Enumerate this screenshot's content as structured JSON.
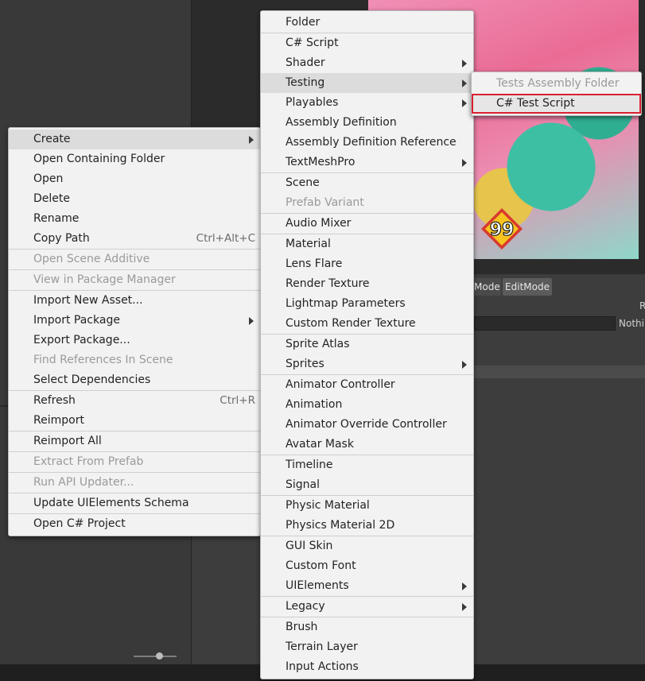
{
  "background": {
    "tabs": [
      "Mode",
      "EditMode"
    ],
    "labels": {
      "nothing": "Nothin",
      "r": "R"
    },
    "badge_text": "99"
  },
  "context_menu": {
    "groups": [
      [
        {
          "label": "Create",
          "submenu": true,
          "highlighted": true
        },
        {
          "label": "Open Containing Folder"
        },
        {
          "label": "Open"
        },
        {
          "label": "Delete"
        },
        {
          "label": "Rename"
        },
        {
          "label": "Copy Path",
          "shortcut": "Ctrl+Alt+C"
        }
      ],
      [
        {
          "label": "Open Scene Additive",
          "disabled": true
        }
      ],
      [
        {
          "label": "View in Package Manager",
          "disabled": true
        }
      ],
      [
        {
          "label": "Import New Asset..."
        },
        {
          "label": "Import Package",
          "submenu": true
        },
        {
          "label": "Export Package..."
        },
        {
          "label": "Find References In Scene",
          "disabled": true
        },
        {
          "label": "Select Dependencies"
        }
      ],
      [
        {
          "label": "Refresh",
          "shortcut": "Ctrl+R"
        },
        {
          "label": "Reimport"
        }
      ],
      [
        {
          "label": "Reimport All"
        }
      ],
      [
        {
          "label": "Extract From Prefab",
          "disabled": true
        }
      ],
      [
        {
          "label": "Run API Updater...",
          "disabled": true
        }
      ],
      [
        {
          "label": "Update UIElements Schema"
        }
      ],
      [
        {
          "label": "Open C# Project"
        }
      ]
    ]
  },
  "create_menu": {
    "groups": [
      [
        {
          "label": "Folder"
        }
      ],
      [
        {
          "label": "C# Script"
        },
        {
          "label": "Shader",
          "submenu": true
        },
        {
          "label": "Testing",
          "submenu": true,
          "highlighted": true
        },
        {
          "label": "Playables",
          "submenu": true
        },
        {
          "label": "Assembly Definition"
        },
        {
          "label": "Assembly Definition Reference"
        },
        {
          "label": "TextMeshPro",
          "submenu": true
        }
      ],
      [
        {
          "label": "Scene"
        },
        {
          "label": "Prefab Variant",
          "disabled": true
        }
      ],
      [
        {
          "label": "Audio Mixer"
        }
      ],
      [
        {
          "label": "Material"
        },
        {
          "label": "Lens Flare"
        },
        {
          "label": "Render Texture"
        },
        {
          "label": "Lightmap Parameters"
        },
        {
          "label": "Custom Render Texture"
        }
      ],
      [
        {
          "label": "Sprite Atlas"
        },
        {
          "label": "Sprites",
          "submenu": true
        }
      ],
      [
        {
          "label": "Animator Controller"
        },
        {
          "label": "Animation"
        },
        {
          "label": "Animator Override Controller"
        },
        {
          "label": "Avatar Mask"
        }
      ],
      [
        {
          "label": "Timeline"
        },
        {
          "label": "Signal"
        }
      ],
      [
        {
          "label": "Physic Material"
        },
        {
          "label": "Physics Material 2D"
        }
      ],
      [
        {
          "label": "GUI Skin"
        },
        {
          "label": "Custom Font"
        },
        {
          "label": "UIElements",
          "submenu": true
        }
      ],
      [
        {
          "label": "Legacy",
          "submenu": true
        }
      ],
      [
        {
          "label": "Brush"
        },
        {
          "label": "Terrain Layer"
        },
        {
          "label": "Input Actions"
        }
      ]
    ]
  },
  "testing_menu": {
    "groups": [
      [
        {
          "label": "Tests Assembly Folder",
          "disabled": true
        },
        {
          "label": "C# Test Script",
          "selected": true
        }
      ]
    ]
  },
  "colors": {
    "menu_bg": "#f2f2f2",
    "highlight": "#dcdcdc",
    "selection_outline": "#d9212f",
    "disabled_text": "#9a9a9a"
  }
}
